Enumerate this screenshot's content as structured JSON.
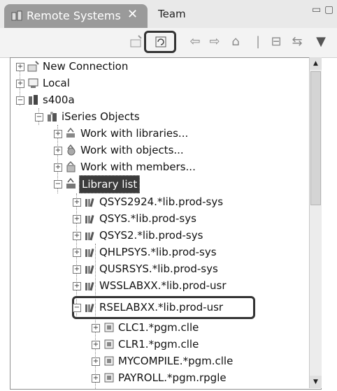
{
  "tabs": {
    "active_label": "Remote Systems",
    "close_glyph": "✕",
    "inactive_label": "Team"
  },
  "window_controls": [
    "minimize-icon",
    "maximize-icon"
  ],
  "toolbar": {
    "buttons": [
      "new-connection-icon",
      "refresh-icon",
      "back-icon",
      "forward-icon",
      "home-icon",
      "collapse-all-icon",
      "link-editor-icon",
      "view-menu-icon"
    ]
  },
  "tree": {
    "nodes": [
      {
        "label": "New Connection",
        "depth": 0,
        "expander": "+",
        "icon": "new-connection-icon"
      },
      {
        "label": "Local",
        "depth": 0,
        "expander": "+",
        "icon": "local-system-icon"
      },
      {
        "label": "s400a",
        "depth": 0,
        "expander": "-",
        "icon": "iseries-system-icon"
      },
      {
        "label": "iSeries Objects",
        "depth": 1,
        "expander": "-",
        "icon": "iseries-objects-icon"
      },
      {
        "label": "Work with libraries...",
        "depth": 2,
        "expander": "+",
        "icon": "work-libraries-icon"
      },
      {
        "label": "Work with objects...",
        "depth": 2,
        "expander": "+",
        "icon": "work-objects-icon"
      },
      {
        "label": "Work with members...",
        "depth": 2,
        "expander": "+",
        "icon": "work-members-icon"
      },
      {
        "label": "Library list",
        "depth": 2,
        "expander": "-",
        "icon": "library-list-icon",
        "selected": true
      },
      {
        "label": "QSYS2924.*lib.prod-sys",
        "depth": 3,
        "expander": "+",
        "icon": "library-icon"
      },
      {
        "label": "QSYS.*lib.prod-sys",
        "depth": 3,
        "expander": "+",
        "icon": "library-icon"
      },
      {
        "label": "QSYS2.*lib.prod-sys",
        "depth": 3,
        "expander": "+",
        "icon": "library-icon"
      },
      {
        "label": "QHLPSYS.*lib.prod-sys",
        "depth": 3,
        "expander": "+",
        "icon": "library-icon"
      },
      {
        "label": "QUSRSYS.*lib.prod-sys",
        "depth": 3,
        "expander": "+",
        "icon": "library-icon"
      },
      {
        "label": "WSSLABXX.*lib.prod-usr",
        "depth": 3,
        "expander": "+",
        "icon": "library-icon"
      },
      {
        "label": "RSELABXX.*lib.prod-usr",
        "depth": 3,
        "expander": "-",
        "icon": "library-icon",
        "boxed": true
      },
      {
        "label": "CLC1.*pgm.clle",
        "depth": 4,
        "expander": "+",
        "icon": "program-icon"
      },
      {
        "label": "CLR1.*pgm.clle",
        "depth": 4,
        "expander": "+",
        "icon": "program-icon"
      },
      {
        "label": "MYCOMPILE.*pgm.clle",
        "depth": 4,
        "expander": "+",
        "icon": "program-icon"
      },
      {
        "label": "PAYROLL.*pgm.rpgle",
        "depth": 4,
        "expander": "+",
        "icon": "program-icon"
      }
    ]
  },
  "scrollbar": {
    "position": 0.0,
    "visible_fraction": 0.45
  }
}
